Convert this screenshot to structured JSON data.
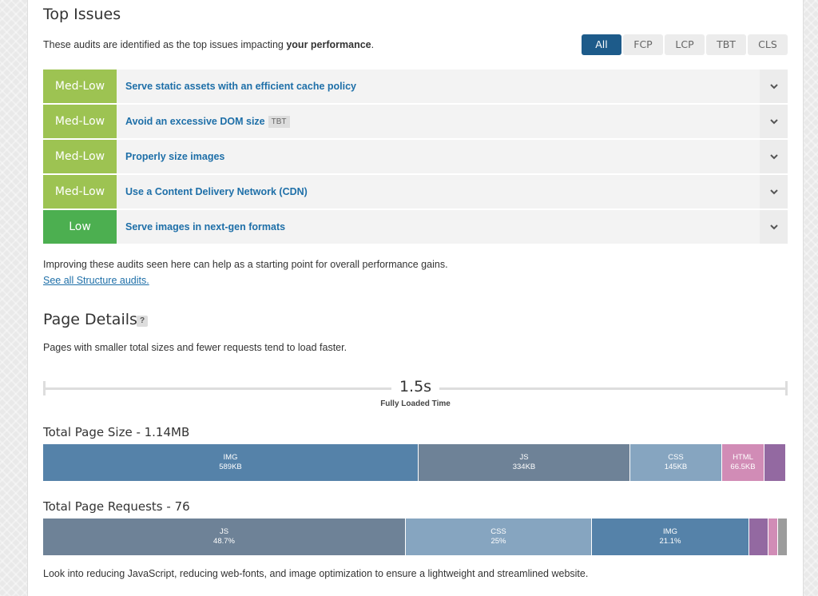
{
  "top_issues": {
    "title": "Top Issues",
    "description_prefix": "These audits are identified as the top issues impacting ",
    "description_bold": "your performance",
    "description_suffix": ".",
    "filters": [
      "All",
      "FCP",
      "LCP",
      "TBT",
      "CLS"
    ],
    "active_filter": "All",
    "issues": [
      {
        "severity": "Med-Low",
        "title": "Serve static assets with an efficient cache policy",
        "tag": ""
      },
      {
        "severity": "Med-Low",
        "title": "Avoid an excessive DOM size",
        "tag": "TBT"
      },
      {
        "severity": "Med-Low",
        "title": "Properly size images",
        "tag": ""
      },
      {
        "severity": "Med-Low",
        "title": "Use a Content Delivery Network (CDN)",
        "tag": ""
      },
      {
        "severity": "Low",
        "title": "Serve images in next-gen formats",
        "tag": ""
      }
    ],
    "footer_text": "Improving these audits seen here can help as a starting point for overall performance gains.",
    "see_all_link": "See all Structure audits."
  },
  "page_details": {
    "title": "Page Details",
    "help": "?",
    "description": "Pages with smaller total sizes and fewer requests tend to load faster.",
    "fully_loaded_time": "1.5s",
    "fully_loaded_label": "Fully Loaded Time",
    "size_title": "Total Page Size - 1.14MB",
    "size_segments": [
      {
        "label": "IMG",
        "value": "589KB",
        "fraction": 0.5043,
        "color": "#5582a9"
      },
      {
        "label": "JS",
        "value": "334KB",
        "fraction": 0.2843,
        "color": "#6e8297"
      },
      {
        "label": "CSS",
        "value": "145KB",
        "fraction": 0.1233,
        "color": "#86a5c0"
      },
      {
        "label": "HTML",
        "value": "66.5KB",
        "fraction": 0.0566,
        "color": "#d18cb6"
      },
      {
        "label": "",
        "value": "",
        "fraction": 0.0288,
        "color": "#9369a1"
      }
    ],
    "requests_title": "Total Page Requests - 76",
    "request_segments": [
      {
        "label": "JS",
        "value": "48.7%",
        "fraction": 0.487,
        "color": "#6e8297"
      },
      {
        "label": "CSS",
        "value": "25%",
        "fraction": 0.25,
        "color": "#86a5c0"
      },
      {
        "label": "IMG",
        "value": "21.1%",
        "fraction": 0.211,
        "color": "#5582a9"
      },
      {
        "label": "",
        "value": "",
        "fraction": 0.026,
        "color": "#9369a1"
      },
      {
        "label": "",
        "value": "",
        "fraction": 0.013,
        "color": "#d18cb6"
      },
      {
        "label": "",
        "value": "",
        "fraction": 0.013,
        "color": "#9c9c9c"
      }
    ],
    "footer_text": "Look into reducing JavaScript, reducing web-fonts, and image optimization to ensure a lightweight and streamlined website."
  },
  "colors": {
    "med_low": "#9dc352",
    "low": "#4caf50",
    "link": "#1e6fa8",
    "filter_active": "#1d5b8a"
  }
}
